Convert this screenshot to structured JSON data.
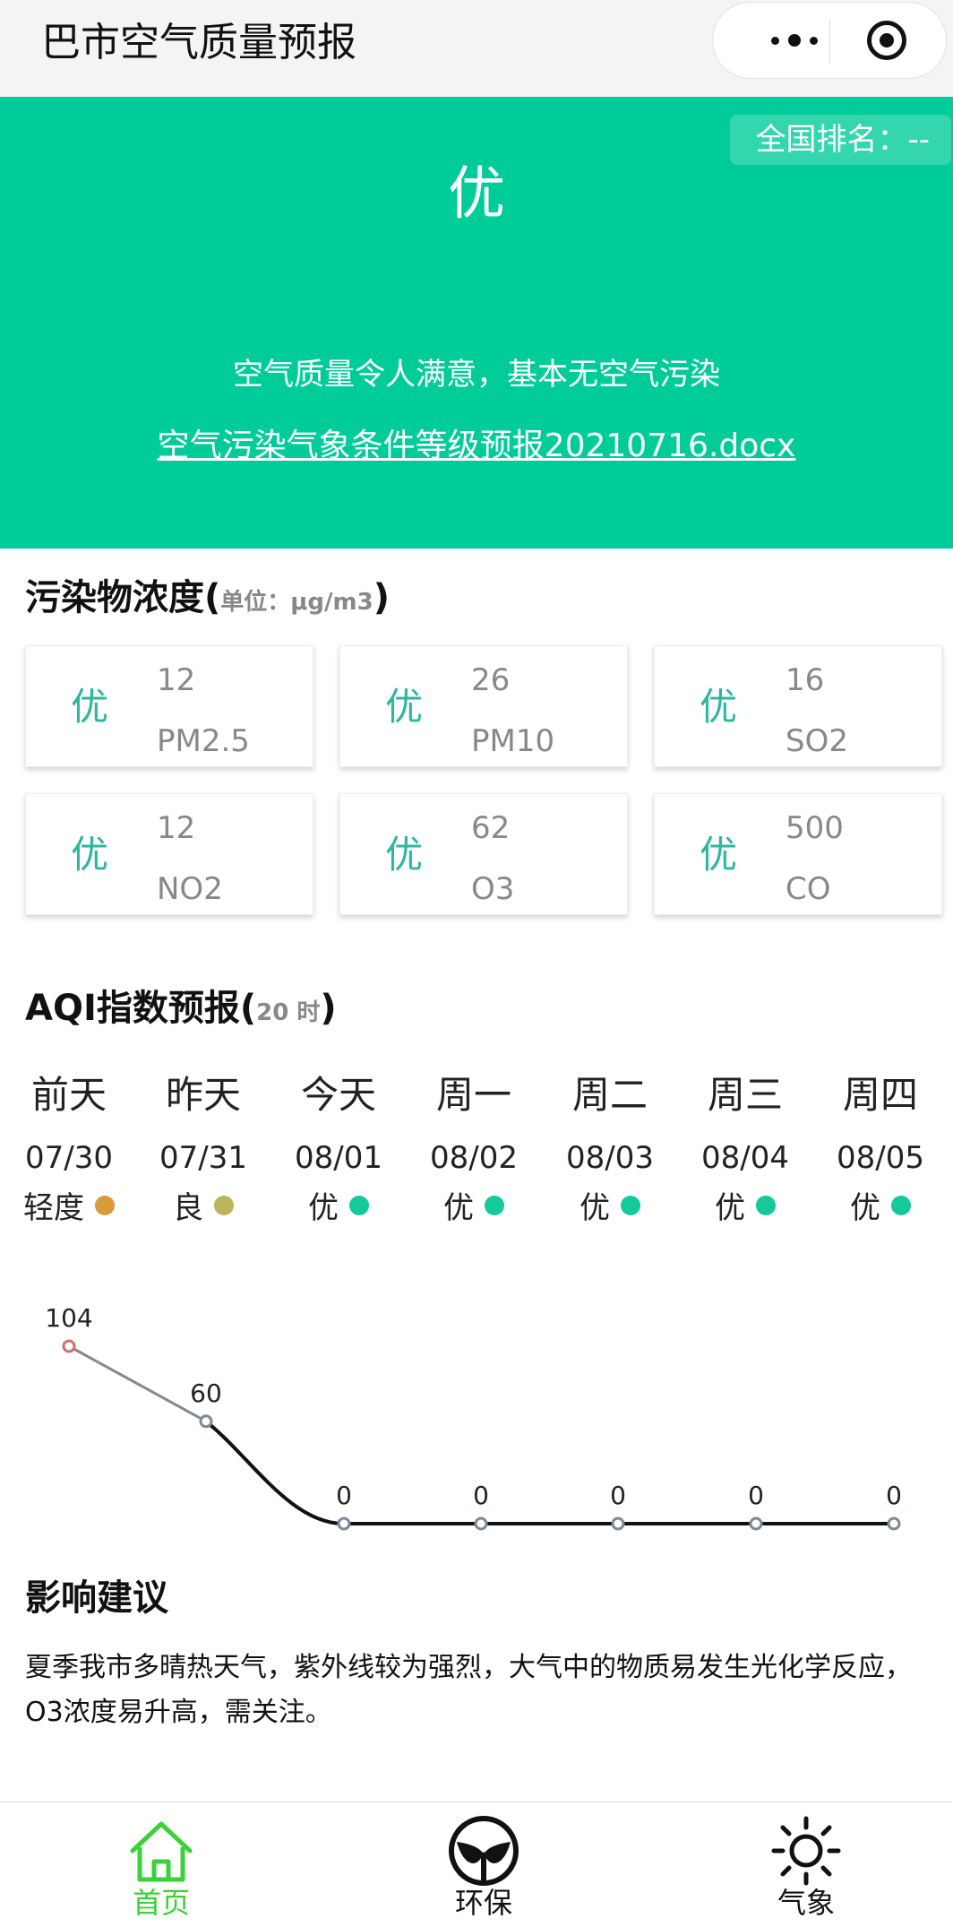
{
  "nav": {
    "title": "巴市空气质量预报"
  },
  "banner": {
    "rank_label": "全国排名：--",
    "level": "优",
    "description": "空气质量令人满意，基本无空气污染",
    "doc_link": "空气污染气象条件等级预报20210716.docx",
    "bg_color": "#00cc99"
  },
  "pollutants": {
    "title": "污染物浓度(",
    "unit": "单位：μg/m3",
    "close": ")",
    "items": [
      {
        "quality": "优",
        "value": "12",
        "name": "PM2.5"
      },
      {
        "quality": "优",
        "value": "26",
        "name": "PM10"
      },
      {
        "quality": "优",
        "value": "16",
        "name": "SO2"
      },
      {
        "quality": "优",
        "value": "12",
        "name": "NO2"
      },
      {
        "quality": "优",
        "value": "62",
        "name": "O3"
      },
      {
        "quality": "优",
        "value": "500",
        "name": "CO"
      }
    ]
  },
  "aqi": {
    "title": "AQI指数预报(",
    "hour": "20 时",
    "close": ")",
    "days": [
      {
        "day": "前天",
        "date": "07/30",
        "level": "轻度",
        "dot_color": "#d99a3c"
      },
      {
        "day": "昨天",
        "date": "07/31",
        "level": "良",
        "dot_color": "#bdb45a"
      },
      {
        "day": "今天",
        "date": "08/01",
        "level": "优",
        "dot_color": "#14c99a"
      },
      {
        "day": "周一",
        "date": "08/02",
        "level": "优",
        "dot_color": "#14c99a"
      },
      {
        "day": "周二",
        "date": "08/03",
        "level": "优",
        "dot_color": "#14c99a"
      },
      {
        "day": "周三",
        "date": "08/04",
        "level": "优",
        "dot_color": "#14c99a"
      },
      {
        "day": "周四",
        "date": "08/05",
        "level": "优",
        "dot_color": "#14c99a"
      }
    ]
  },
  "chart_data": {
    "type": "line",
    "categories": [
      "07/30",
      "07/31",
      "08/01",
      "08/02",
      "08/03",
      "08/04",
      "08/05"
    ],
    "values": [
      104,
      60,
      0,
      0,
      0,
      0,
      0
    ],
    "title": "",
    "xlabel": "",
    "ylabel": "",
    "grid": false
  },
  "advice": {
    "title": "影响建议",
    "text": "夏季我市多晴热天气，紫外线较为强烈，大气中的物质易发生光化学反应，O3浓度易升高，需关注。"
  },
  "tabbar": {
    "active_color": "#3ad13a",
    "items": [
      {
        "label": "首页",
        "icon": "home-icon"
      },
      {
        "label": "环保",
        "icon": "leaf-icon"
      },
      {
        "label": "气象",
        "icon": "sun-icon"
      }
    ]
  }
}
